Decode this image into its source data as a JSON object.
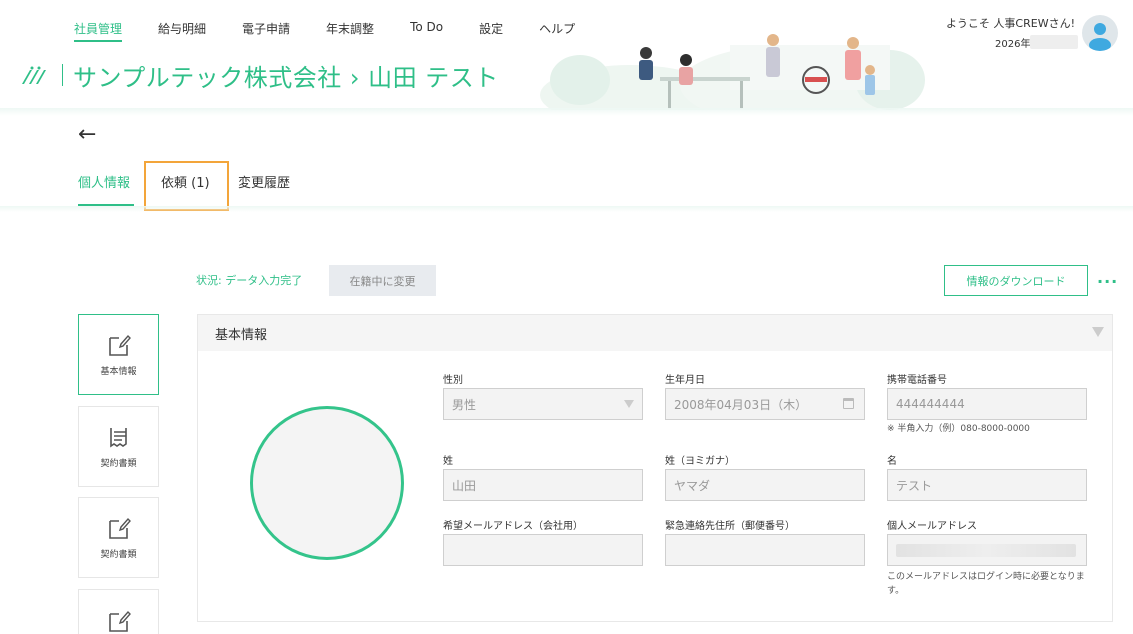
{
  "nav": {
    "items": [
      "社員管理",
      "給与明細",
      "電子申請",
      "年末調整",
      "To Do",
      "設定",
      "ヘルプ"
    ]
  },
  "header": {
    "company": "サンプルテック株式会社 › 山田 テスト",
    "welcome": "ようこそ 人事CREWさん!",
    "year": "2026年"
  },
  "tabs": {
    "personal": "個人情報",
    "requests": "依頼 (1)",
    "history": "変更履歴"
  },
  "status": {
    "text": "状況: データ入力完了",
    "change_label": "在籍中に変更",
    "download_label": "情報のダウンロード",
    "more": "..."
  },
  "side": {
    "items": [
      "基本情報",
      "契約書類",
      "契約書類",
      ""
    ]
  },
  "panel": {
    "title": "基本情報",
    "fields": {
      "gender": {
        "label": "性別",
        "value": "男性"
      },
      "birthday": {
        "label": "生年月日",
        "value": "2008年04月03日（木）"
      },
      "mobile": {
        "label": "携帯電話番号",
        "value": "444444444",
        "hint": "※ 半角入力（例）080-8000-0000"
      },
      "last_name": {
        "label": "姓",
        "value": "山田"
      },
      "last_kana": {
        "label": "姓（ヨミガナ）",
        "value": "ヤマダ"
      },
      "first_name": {
        "label": "名",
        "value": "テスト"
      },
      "work_email": {
        "label": "希望メールアドレス（会社用）",
        "value": ""
      },
      "emergency_zip": {
        "label": "緊急連絡先住所（郵便番号）",
        "value": ""
      },
      "personal_email": {
        "label": "個人メールアドレス",
        "hint": "このメールアドレスはログイン時に必要となります。"
      }
    }
  },
  "colors": {
    "brand": "#2fbf88",
    "highlight": "#f3a53a"
  }
}
